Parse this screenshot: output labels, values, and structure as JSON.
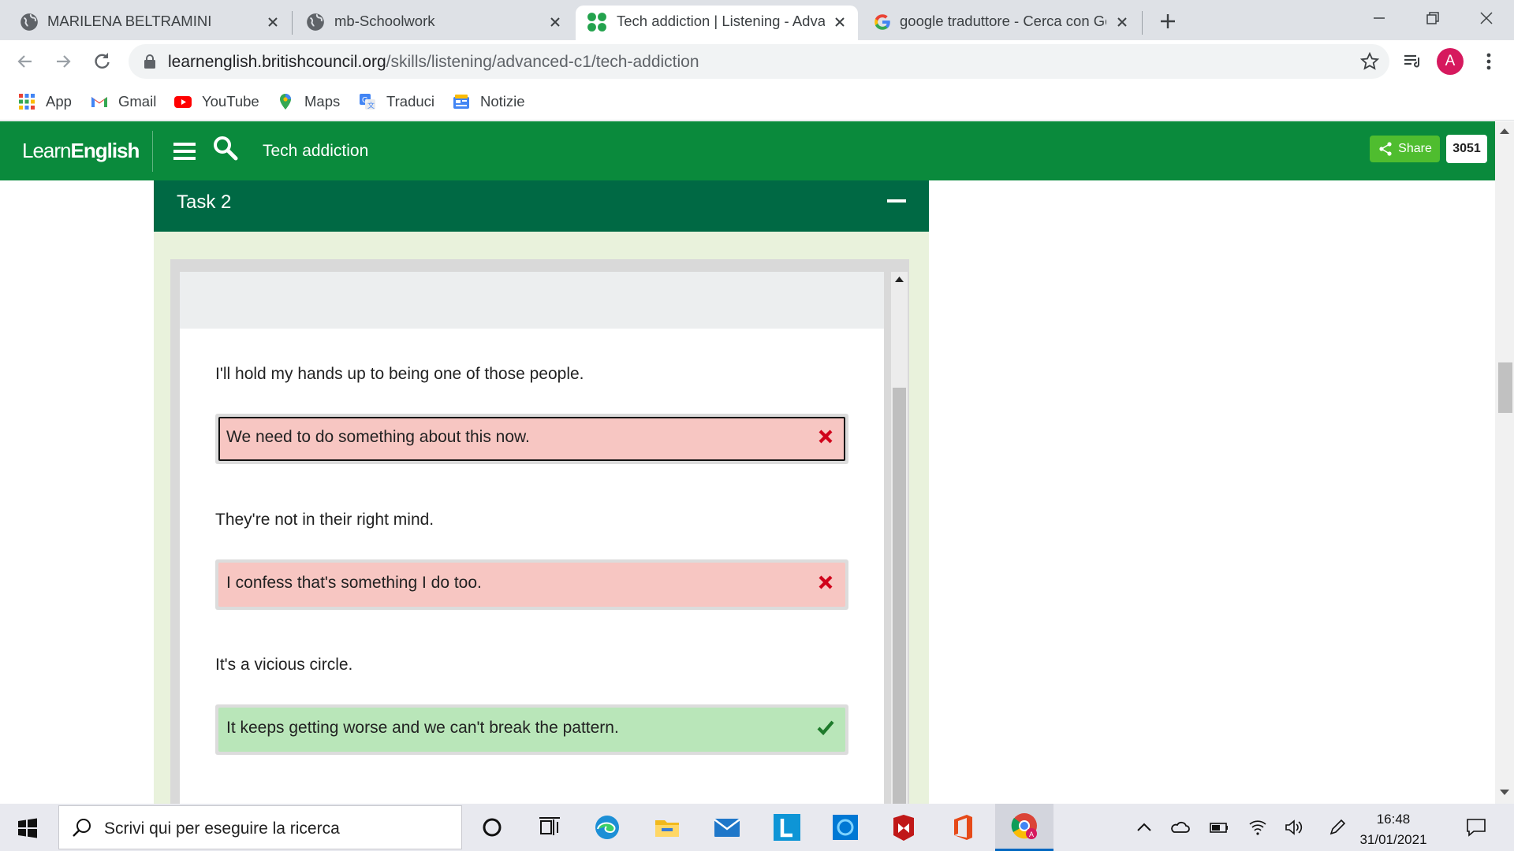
{
  "browser": {
    "tabs": [
      {
        "title": "MARILENA BELTRAMINI",
        "favicon": "globe-icon",
        "active": false
      },
      {
        "title": "mb-Schoolwork",
        "favicon": "globe-icon",
        "active": false
      },
      {
        "title": "Tech addiction | Listening - Advan",
        "favicon": "british-council-icon",
        "active": true
      },
      {
        "title": "google traduttore - Cerca con Go",
        "favicon": "google-icon",
        "active": false
      }
    ],
    "url_host": "learnenglish.britishcouncil.org",
    "url_path": "/skills/listening/advanced-c1/tech-addiction",
    "profile_initial": "A",
    "bookmarks": [
      "App",
      "Gmail",
      "YouTube",
      "Maps",
      "Traduci",
      "Notizie"
    ]
  },
  "site": {
    "logo_light": "Learn",
    "logo_bold": "English",
    "page_title": "Tech addiction",
    "share_label": "Share",
    "share_count": "3051",
    "brand_color": "#0a8a3c"
  },
  "task": {
    "title": "Task 2",
    "items": [
      {
        "prompt": "I'll hold my hands up to being one of those people.",
        "answer": "We need to do something about this now.",
        "status": "wrong"
      },
      {
        "prompt": "They're not in their right mind.",
        "answer": "I confess that's something I do too.",
        "status": "wrong"
      },
      {
        "prompt": "It's a vicious circle.",
        "answer": "It keeps getting worse and we can't break the pattern.",
        "status": "correct"
      }
    ],
    "colors": {
      "wrong_bg": "#f7c6c2",
      "correct_bg": "#b9e6b9",
      "wrong_mark": "#d0021b",
      "correct_mark": "#1e7a2b"
    }
  },
  "taskbar": {
    "search_placeholder": "Scrivi qui per eseguire la ricerca",
    "time": "16:48",
    "date": "31/01/2021"
  }
}
